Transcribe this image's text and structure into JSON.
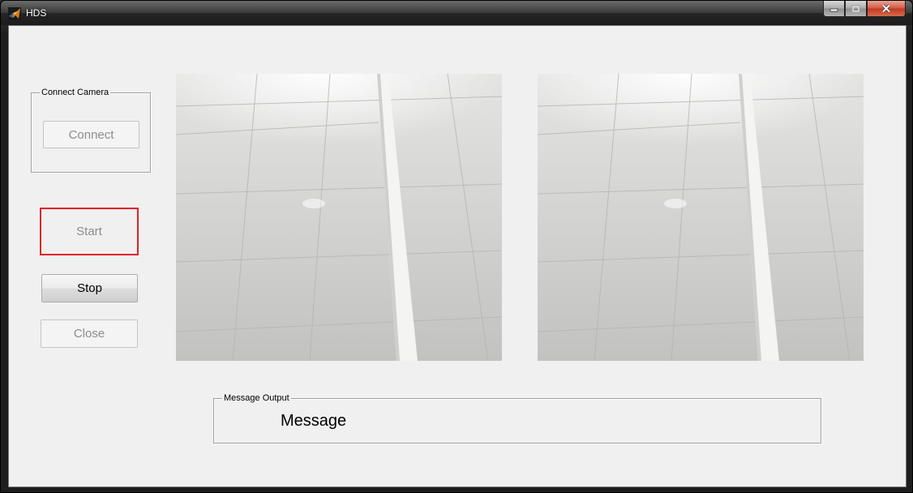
{
  "window": {
    "title": "HDS",
    "icon": "matlab-icon",
    "caption_buttons": [
      "minimize-icon",
      "maximize-icon",
      "close-icon"
    ]
  },
  "connect_panel": {
    "title": "Connect Camera",
    "connect_label": "Connect"
  },
  "controls": {
    "start_label": "Start",
    "stop_label": "Stop",
    "close_label": "Close"
  },
  "views": [
    {
      "name": "camera-view-left",
      "content": "floor tile image"
    },
    {
      "name": "camera-view-right",
      "content": "floor tile image"
    }
  ],
  "message_panel": {
    "title": "Message Output",
    "message": "Message"
  },
  "colors": {
    "focus_outline": "#e0202a",
    "window_background": "#f0f0f0"
  }
}
